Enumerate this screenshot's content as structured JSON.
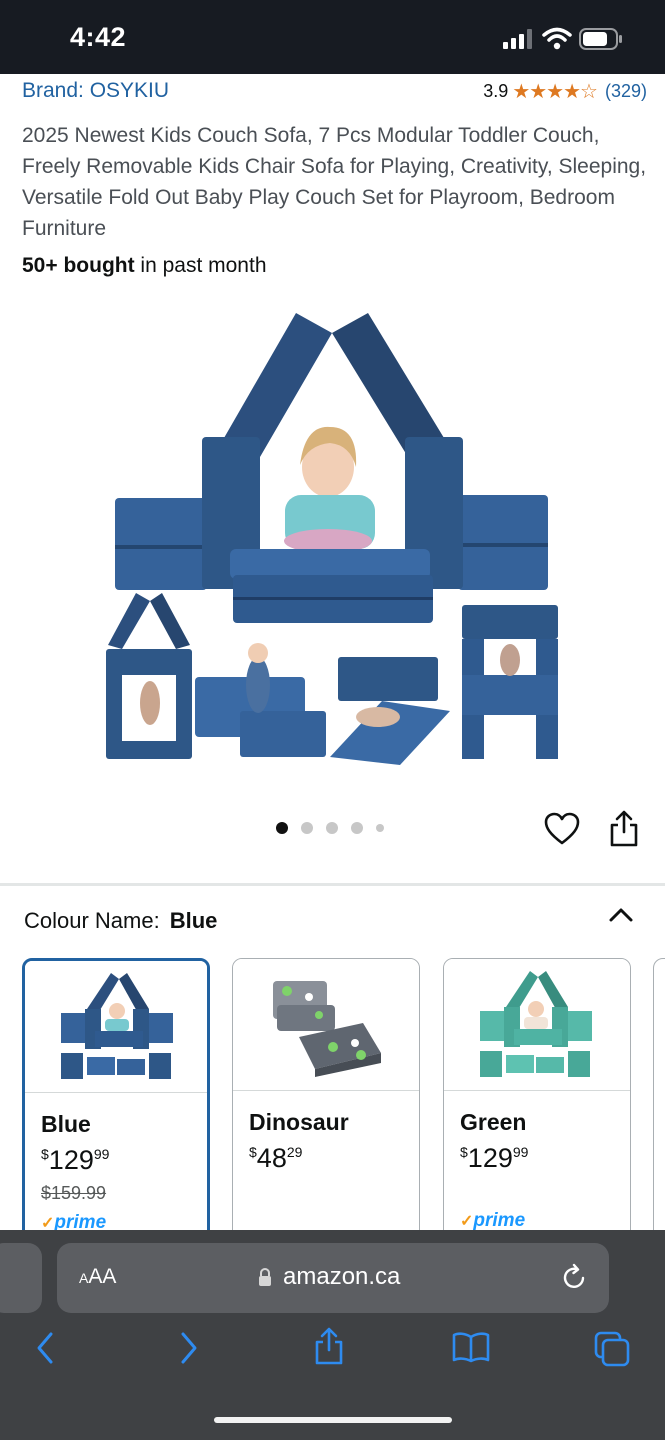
{
  "status_bar": {
    "time": "4:42"
  },
  "product": {
    "brand": "Brand: OSYKIU",
    "rating": "3.9",
    "stars": "★★★★☆",
    "review_count": "(329)",
    "title": "2025 Newest Kids Couch Sofa, 7 Pcs Modular Toddler Couch, Freely Removable Kids Chair Sofa for Playing, Creativity, Sleeping, Versatile Fold Out Baby Play Couch Set for Playroom, Bedroom Furniture",
    "bought_bold": "50+ bought",
    "bought_rest": " in past month"
  },
  "gallery": {
    "image_count": 5,
    "active_index": 0
  },
  "colour": {
    "label": "Colour Name:",
    "selected": "Blue",
    "options": [
      {
        "name": "Blue",
        "currency": "$",
        "price_whole": "129",
        "price_cents": "99",
        "was": "$159.99",
        "prime": "prime",
        "color": "#2f5a8f"
      },
      {
        "name": "Dinosaur",
        "currency": "$",
        "price_whole": "48",
        "price_cents": "29",
        "was": "",
        "prime": "",
        "color": "#7d8590"
      },
      {
        "name": "Green",
        "currency": "$",
        "price_whole": "129",
        "price_cents": "99",
        "was": "",
        "prime": "prime",
        "color": "#4fb3a3"
      }
    ]
  },
  "browser": {
    "aa": "AA",
    "url": "amazon.ca"
  },
  "colors": {
    "link": "#2162a1",
    "star": "#de7921",
    "sofa_blue": "#2f5a8f",
    "browser_bg": "#3f4144",
    "ios_blue": "#2e8bf0"
  }
}
